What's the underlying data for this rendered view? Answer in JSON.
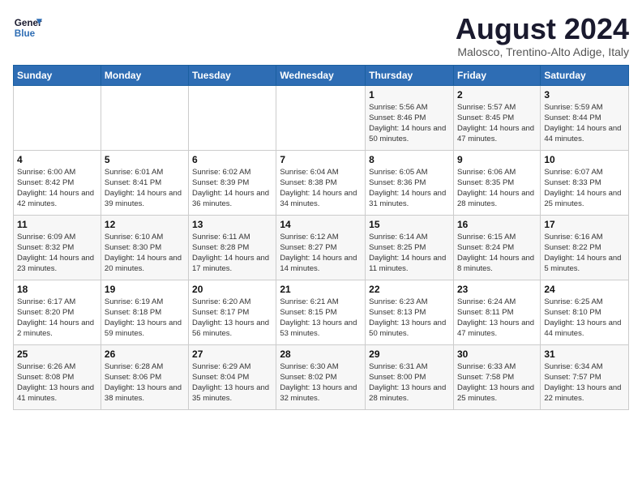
{
  "logo": {
    "line1": "General",
    "line2": "Blue"
  },
  "title": "August 2024",
  "subtitle": "Malosco, Trentino-Alto Adige, Italy",
  "weekdays": [
    "Sunday",
    "Monday",
    "Tuesday",
    "Wednesday",
    "Thursday",
    "Friday",
    "Saturday"
  ],
  "weeks": [
    [
      {
        "day": "",
        "info": ""
      },
      {
        "day": "",
        "info": ""
      },
      {
        "day": "",
        "info": ""
      },
      {
        "day": "",
        "info": ""
      },
      {
        "day": "1",
        "info": "Sunrise: 5:56 AM\nSunset: 8:46 PM\nDaylight: 14 hours and 50 minutes."
      },
      {
        "day": "2",
        "info": "Sunrise: 5:57 AM\nSunset: 8:45 PM\nDaylight: 14 hours and 47 minutes."
      },
      {
        "day": "3",
        "info": "Sunrise: 5:59 AM\nSunset: 8:44 PM\nDaylight: 14 hours and 44 minutes."
      }
    ],
    [
      {
        "day": "4",
        "info": "Sunrise: 6:00 AM\nSunset: 8:42 PM\nDaylight: 14 hours and 42 minutes."
      },
      {
        "day": "5",
        "info": "Sunrise: 6:01 AM\nSunset: 8:41 PM\nDaylight: 14 hours and 39 minutes."
      },
      {
        "day": "6",
        "info": "Sunrise: 6:02 AM\nSunset: 8:39 PM\nDaylight: 14 hours and 36 minutes."
      },
      {
        "day": "7",
        "info": "Sunrise: 6:04 AM\nSunset: 8:38 PM\nDaylight: 14 hours and 34 minutes."
      },
      {
        "day": "8",
        "info": "Sunrise: 6:05 AM\nSunset: 8:36 PM\nDaylight: 14 hours and 31 minutes."
      },
      {
        "day": "9",
        "info": "Sunrise: 6:06 AM\nSunset: 8:35 PM\nDaylight: 14 hours and 28 minutes."
      },
      {
        "day": "10",
        "info": "Sunrise: 6:07 AM\nSunset: 8:33 PM\nDaylight: 14 hours and 25 minutes."
      }
    ],
    [
      {
        "day": "11",
        "info": "Sunrise: 6:09 AM\nSunset: 8:32 PM\nDaylight: 14 hours and 23 minutes."
      },
      {
        "day": "12",
        "info": "Sunrise: 6:10 AM\nSunset: 8:30 PM\nDaylight: 14 hours and 20 minutes."
      },
      {
        "day": "13",
        "info": "Sunrise: 6:11 AM\nSunset: 8:28 PM\nDaylight: 14 hours and 17 minutes."
      },
      {
        "day": "14",
        "info": "Sunrise: 6:12 AM\nSunset: 8:27 PM\nDaylight: 14 hours and 14 minutes."
      },
      {
        "day": "15",
        "info": "Sunrise: 6:14 AM\nSunset: 8:25 PM\nDaylight: 14 hours and 11 minutes."
      },
      {
        "day": "16",
        "info": "Sunrise: 6:15 AM\nSunset: 8:24 PM\nDaylight: 14 hours and 8 minutes."
      },
      {
        "day": "17",
        "info": "Sunrise: 6:16 AM\nSunset: 8:22 PM\nDaylight: 14 hours and 5 minutes."
      }
    ],
    [
      {
        "day": "18",
        "info": "Sunrise: 6:17 AM\nSunset: 8:20 PM\nDaylight: 14 hours and 2 minutes."
      },
      {
        "day": "19",
        "info": "Sunrise: 6:19 AM\nSunset: 8:18 PM\nDaylight: 13 hours and 59 minutes."
      },
      {
        "day": "20",
        "info": "Sunrise: 6:20 AM\nSunset: 8:17 PM\nDaylight: 13 hours and 56 minutes."
      },
      {
        "day": "21",
        "info": "Sunrise: 6:21 AM\nSunset: 8:15 PM\nDaylight: 13 hours and 53 minutes."
      },
      {
        "day": "22",
        "info": "Sunrise: 6:23 AM\nSunset: 8:13 PM\nDaylight: 13 hours and 50 minutes."
      },
      {
        "day": "23",
        "info": "Sunrise: 6:24 AM\nSunset: 8:11 PM\nDaylight: 13 hours and 47 minutes."
      },
      {
        "day": "24",
        "info": "Sunrise: 6:25 AM\nSunset: 8:10 PM\nDaylight: 13 hours and 44 minutes."
      }
    ],
    [
      {
        "day": "25",
        "info": "Sunrise: 6:26 AM\nSunset: 8:08 PM\nDaylight: 13 hours and 41 minutes."
      },
      {
        "day": "26",
        "info": "Sunrise: 6:28 AM\nSunset: 8:06 PM\nDaylight: 13 hours and 38 minutes."
      },
      {
        "day": "27",
        "info": "Sunrise: 6:29 AM\nSunset: 8:04 PM\nDaylight: 13 hours and 35 minutes."
      },
      {
        "day": "28",
        "info": "Sunrise: 6:30 AM\nSunset: 8:02 PM\nDaylight: 13 hours and 32 minutes."
      },
      {
        "day": "29",
        "info": "Sunrise: 6:31 AM\nSunset: 8:00 PM\nDaylight: 13 hours and 28 minutes."
      },
      {
        "day": "30",
        "info": "Sunrise: 6:33 AM\nSunset: 7:58 PM\nDaylight: 13 hours and 25 minutes."
      },
      {
        "day": "31",
        "info": "Sunrise: 6:34 AM\nSunset: 7:57 PM\nDaylight: 13 hours and 22 minutes."
      }
    ]
  ]
}
